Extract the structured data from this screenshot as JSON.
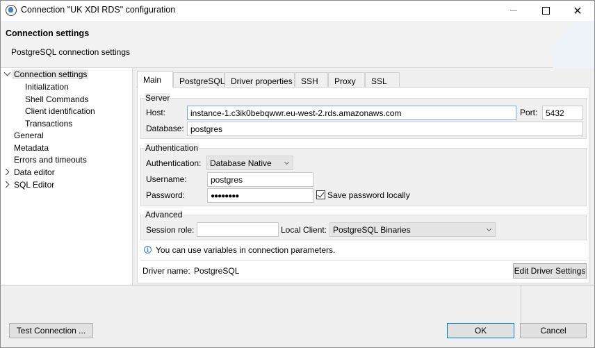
{
  "window": {
    "title": "Connection \"UK XDI RDS\" configuration",
    "close_glyph": "✕"
  },
  "header": {
    "title": "Connection settings",
    "description": "PostgreSQL connection settings"
  },
  "tree": {
    "items": [
      {
        "label": "Connection settings",
        "expanded": true,
        "selected": true
      },
      {
        "label": "Initialization"
      },
      {
        "label": "Shell Commands"
      },
      {
        "label": "Client identification"
      },
      {
        "label": "Transactions"
      },
      {
        "label": "General"
      },
      {
        "label": "Metadata"
      },
      {
        "label": "Errors and timeouts"
      },
      {
        "label": "Data editor",
        "expandable": true
      },
      {
        "label": "SQL Editor",
        "expandable": true
      }
    ]
  },
  "tabs": [
    "Main",
    "PostgreSQL",
    "Driver properties",
    "SSH",
    "Proxy",
    "SSL"
  ],
  "server": {
    "group_label": "Server",
    "host_label": "Host:",
    "host_value": "instance-1.c3ik0bebqwwr.eu-west-2.rds.amazonaws.com",
    "port_label": "Port:",
    "port_value": "5432",
    "database_label": "Database:",
    "database_value": "postgres"
  },
  "auth": {
    "group_label": "Authentication",
    "auth_label": "Authentication:",
    "auth_value": "Database Native",
    "username_label": "Username:",
    "username_value": "postgres",
    "password_label": "Password:",
    "password_value": "●●●●●●●●",
    "save_password_label": "Save password locally"
  },
  "advanced": {
    "group_label": "Advanced",
    "session_role_label": "Session role:",
    "session_role_value": "",
    "local_client_label": "Local Client:",
    "local_client_value": "PostgreSQL Binaries"
  },
  "info": {
    "icon_glyph": "i",
    "text": "You can use variables in connection parameters."
  },
  "driver": {
    "label": "Driver name:",
    "value": "PostgreSQL",
    "edit_button": "Edit Driver Settings"
  },
  "footer": {
    "test_button": "Test Connection ...",
    "ok_button": "OK",
    "cancel_button": "Cancel"
  }
}
